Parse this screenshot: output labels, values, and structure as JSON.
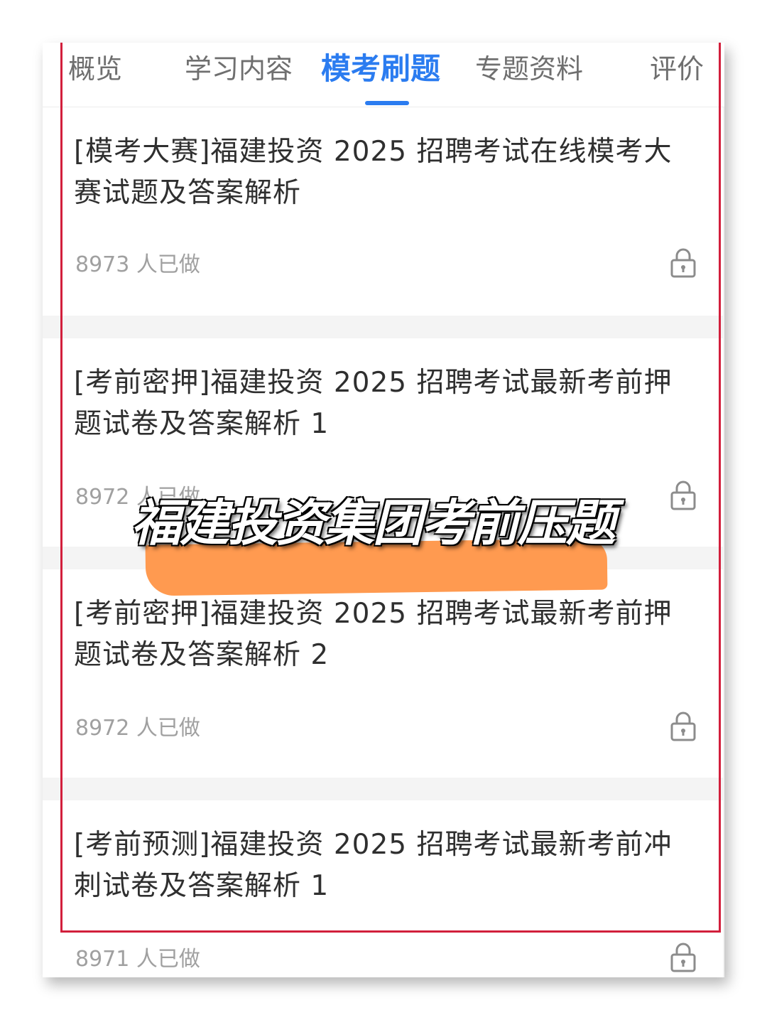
{
  "tabs": [
    {
      "label": "概览"
    },
    {
      "label": "学习内容"
    },
    {
      "label": "模考刷题",
      "active": true
    },
    {
      "label": "专题资料"
    },
    {
      "label": "评价"
    }
  ],
  "exams": [
    {
      "title": "[模考大赛]福建投资 2025 招聘考试在线模考大赛试题及答案解析",
      "count": "8973 人已做",
      "icon": "lock-icon"
    },
    {
      "title": "[考前密押]福建投资 2025 招聘考试最新考前押题试卷及答案解析 1",
      "count": "8972 人已做",
      "icon": "lock-icon"
    },
    {
      "title": "[考前密押]福建投资 2025 招聘考试最新考前押题试卷及答案解析 2",
      "count": "8972 人已做",
      "icon": "lock-icon"
    },
    {
      "title": "[考前预测]福建投资 2025 招聘考试最新考前冲刺试卷及答案解析 1",
      "count": "8971 人已做",
      "icon": "lock-icon"
    }
  ],
  "overlay": {
    "caption": "福建投资集团考前压题"
  },
  "colors": {
    "accent": "#2b7cf0",
    "highlight_frame": "#d21f3c",
    "marker": "#ff9a50"
  }
}
